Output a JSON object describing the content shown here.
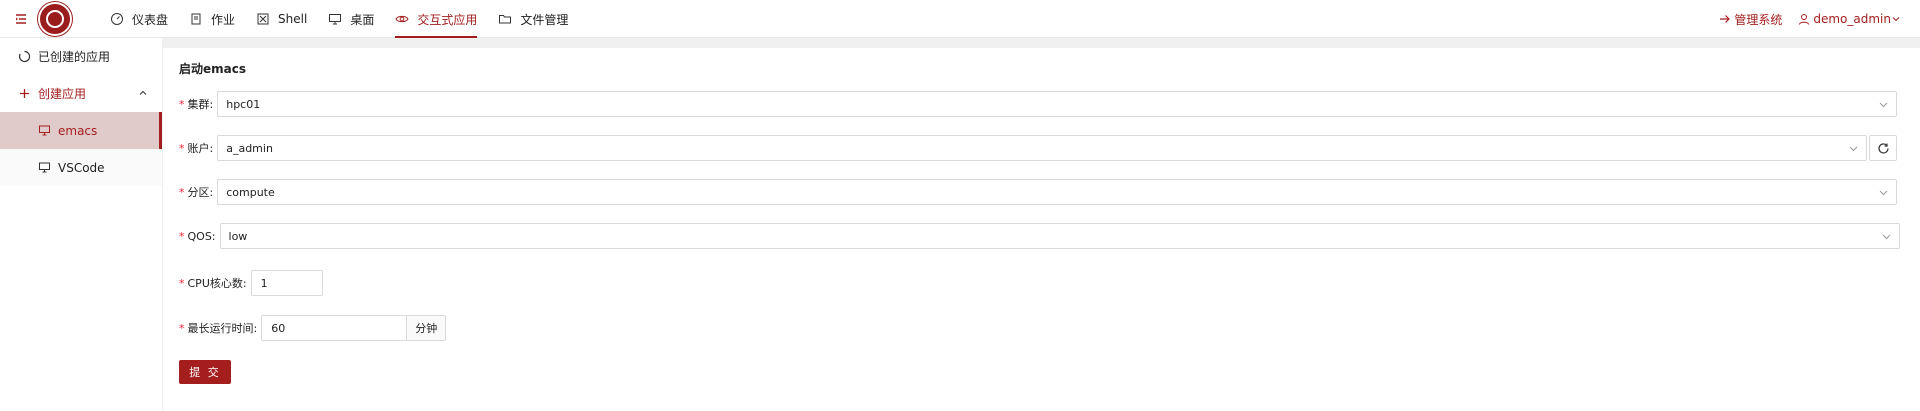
{
  "header": {
    "nav": [
      {
        "label": "仪表盘",
        "icon": "dashboard-icon"
      },
      {
        "label": "作业",
        "icon": "job-icon"
      },
      {
        "label": "Shell",
        "icon": "shell-icon"
      },
      {
        "label": "桌面",
        "icon": "desktop-icon"
      },
      {
        "label": "交互式应用",
        "icon": "eye-icon",
        "active": true
      },
      {
        "label": "文件管理",
        "icon": "folder-icon"
      }
    ],
    "admin_link": "管理系统",
    "user": "demo_admin"
  },
  "sidebar": {
    "created_apps": "已创建的应用",
    "create_app": "创建应用",
    "apps": [
      {
        "label": "emacs",
        "selected": true
      },
      {
        "label": "VSCode",
        "selected": false
      }
    ]
  },
  "form": {
    "title": "启动emacs",
    "cluster": {
      "label": "集群:",
      "value": "hpc01"
    },
    "account": {
      "label": "账户:",
      "value": "a_admin"
    },
    "partition": {
      "label": "分区:",
      "value": "compute"
    },
    "qos": {
      "label": "QOS:",
      "value": "low"
    },
    "cpu": {
      "label": "CPU核心数:",
      "value": "1"
    },
    "max_time": {
      "label": "最长运行时间:",
      "value": "60",
      "unit": "分钟"
    },
    "submit": "提 交"
  },
  "colors": {
    "accent": "#a41e1e",
    "selected_bg": "#e1caca",
    "page_bg": "#f0f0f0"
  }
}
